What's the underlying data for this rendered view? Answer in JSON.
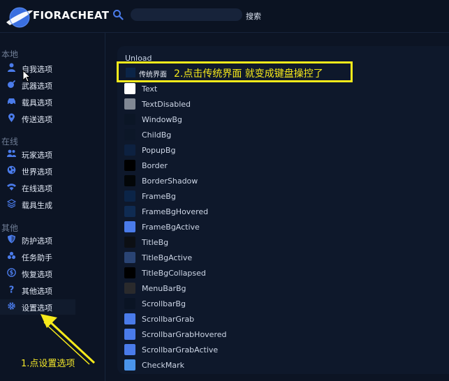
{
  "header": {
    "brand": "FIORACHEAT",
    "search_placeholder": "",
    "search_label": "搜索"
  },
  "sidebar": {
    "sections": [
      {
        "title": "本地",
        "items": [
          {
            "label": "自我选项",
            "icon": "user-icon"
          },
          {
            "label": "武器选项",
            "icon": "bomb-icon"
          },
          {
            "label": "载具选项",
            "icon": "car-icon"
          },
          {
            "label": "传送选项",
            "icon": "map-pin-icon"
          }
        ]
      },
      {
        "title": "在线",
        "items": [
          {
            "label": "玩家选项",
            "icon": "users-icon"
          },
          {
            "label": "世界选项",
            "icon": "globe-icon"
          },
          {
            "label": "在线选项",
            "icon": "wifi-icon"
          },
          {
            "label": "载具生成",
            "icon": "layers-icon"
          }
        ]
      },
      {
        "title": "其他",
        "items": [
          {
            "label": "防护选项",
            "icon": "shield-icon"
          },
          {
            "label": "任务助手",
            "icon": "biohazard-icon"
          },
          {
            "label": "恢复选项",
            "icon": "dollar-icon"
          },
          {
            "label": "其他选项",
            "icon": "question-icon"
          },
          {
            "label": "设置选项",
            "icon": "gear-icon"
          }
        ]
      }
    ]
  },
  "main": {
    "unload_label": "Unload",
    "highlight_item_label": "传统界面",
    "highlight_item_color": "#0b2447",
    "colors": [
      {
        "name": "Text",
        "color": "#ffffff"
      },
      {
        "name": "TextDisabled",
        "color": "#808894"
      },
      {
        "name": "WindowBg",
        "color": "#0b1626"
      },
      {
        "name": "ChildBg",
        "color": "#0c1728"
      },
      {
        "name": "PopupBg",
        "color": "#0d2140"
      },
      {
        "name": "Border",
        "color": "#000000"
      },
      {
        "name": "BorderShadow",
        "color": "#030608"
      },
      {
        "name": "FrameBg",
        "color": "#0b2447"
      },
      {
        "name": "FrameBgHovered",
        "color": "#0f2b52"
      },
      {
        "name": "FrameBgActive",
        "color": "#4a7bea"
      },
      {
        "name": "TitleBg",
        "color": "#0c0f14"
      },
      {
        "name": "TitleBgActive",
        "color": "#2a4474"
      },
      {
        "name": "TitleBgCollapsed",
        "color": "#000000"
      },
      {
        "name": "MenuBarBg",
        "color": "#2a2a2c"
      },
      {
        "name": "ScrollbarBg",
        "color": "#0a1424"
      },
      {
        "name": "ScrollbarGrab",
        "color": "#4a7bea"
      },
      {
        "name": "ScrollbarGrabHovered",
        "color": "#4a7bea"
      },
      {
        "name": "ScrollbarGrabActive",
        "color": "#4a7bea"
      },
      {
        "name": "CheckMark",
        "color": "#4a94ea"
      }
    ]
  },
  "annotations": {
    "step1": "1.点设置选项",
    "step2": "2.点击传统界面 就变成键盘操控了",
    "color": "#f7ea1b"
  },
  "theme": {
    "background": "#0c1424",
    "accent": "#4a7bea"
  }
}
